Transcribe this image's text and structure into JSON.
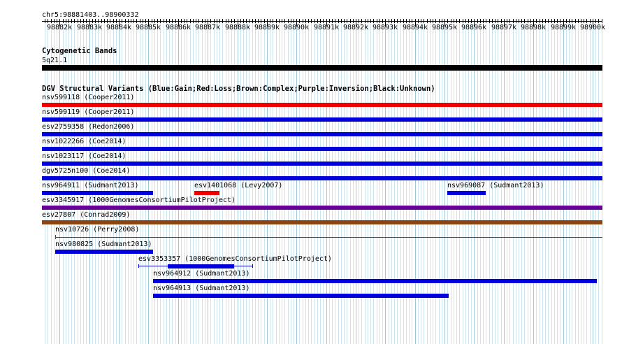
{
  "location": "chr5:98881403..98900332",
  "ruler_ticks": [
    "98882k",
    "98883k",
    "98884k",
    "98885k",
    "98886k",
    "98887k",
    "98888k",
    "98889k",
    "98890k",
    "98891k",
    "98892k",
    "98893k",
    "98894k",
    "98895k",
    "98896k",
    "98897k",
    "98898k",
    "98899k",
    "98900k"
  ],
  "tracks": {
    "cytoband": {
      "title": "Cytogenetic Bands",
      "band_label": "5q21.1"
    },
    "dgv": {
      "title": "DGV Structural Variants (Blue:Gain;Red:Loss;Brown:Complex;Purple:Inversion;Black:Unknown)"
    }
  },
  "colors": {
    "gain": "#0000dd",
    "loss": "#ee0000",
    "complex": "#8b4513",
    "inversion": "#660099",
    "unknown": "#000000",
    "grid_major": "#9ec7d8",
    "grid_minor": "#cfe3ec"
  },
  "features": [
    {
      "label": "nsv599118 (Cooper2011)",
      "type": "loss",
      "start": 98881403,
      "end": 98900332
    },
    {
      "label": "nsv599119 (Cooper2011)",
      "type": "gain",
      "start": 98881403,
      "end": 98900332
    },
    {
      "label": "esv2759358 (Redon2006)",
      "type": "gain",
      "start": 98881403,
      "end": 98900332
    },
    {
      "label": "nsv1022266 (Coe2014)",
      "type": "gain",
      "start": 98881403,
      "end": 98900332
    },
    {
      "label": "nsv1023117 (Coe2014)",
      "type": "gain",
      "start": 98881403,
      "end": 98900332
    },
    {
      "label": "dgv5725n100 (Coe2014)",
      "type": "gain",
      "start": 98881403,
      "end": 98900332
    },
    {
      "label": "nsv964911 (Sudmant2013)",
      "type": "gain",
      "start": 98881403,
      "end": 98885150
    },
    {
      "label": "esv1401068 (Levy2007)",
      "type": "loss",
      "start": 98886550,
      "end": 98887400
    },
    {
      "label": "nsv969087 (Sudmant2013)",
      "type": "gain",
      "start": 98895100,
      "end": 98896400
    },
    {
      "label": "esv3345917 (1000GenomesConsortiumPilotProject)",
      "type": "inversion",
      "start": 98881403,
      "end": 98900332
    },
    {
      "label": "esv27807 (Conrad2009)",
      "type": "complex",
      "start": 98881403,
      "end": 98900332
    },
    {
      "label": "nsv10726 (Perry2008)",
      "type": "loss",
      "start": 98881850,
      "end": 98900332,
      "thin": true
    },
    {
      "label": "nsv980825 (Sudmant2013)",
      "type": "gain",
      "start": 98881850,
      "end": 98885150
    },
    {
      "label": "esv3353357 (1000GenomesConsortiumPilotProject)",
      "type": "gain",
      "start": 98884650,
      "end": 98888500,
      "whisker": true
    },
    {
      "label": "nsv964912 (Sudmant2013)",
      "type": "gain",
      "start": 98885150,
      "end": 98900150
    },
    {
      "label": "nsv964913 (Sudmant2013)",
      "type": "gain",
      "start": 98885150,
      "end": 98895150
    }
  ]
}
